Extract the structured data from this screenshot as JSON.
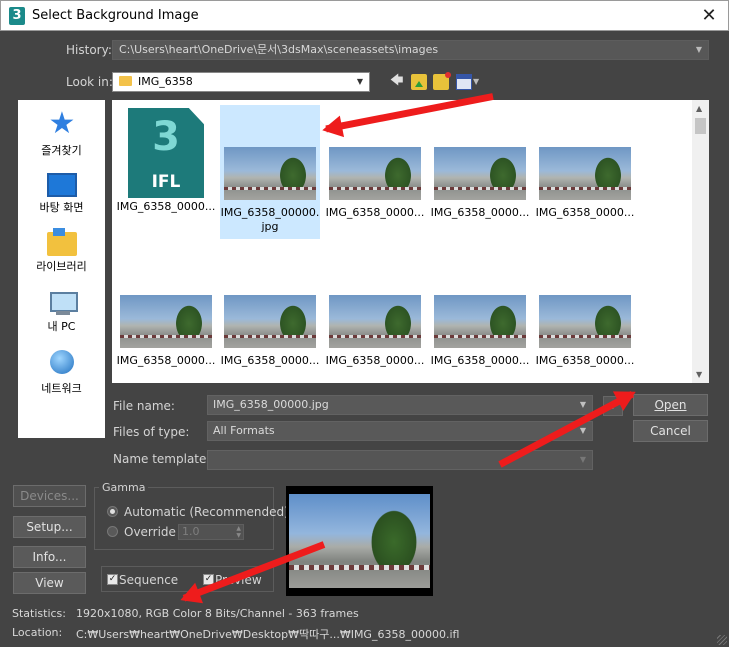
{
  "window": {
    "title": "Select Background Image",
    "close": "✕",
    "app_glyph": "3"
  },
  "history": {
    "label": "History:",
    "value": "C:\\Users\\heart\\OneDrive\\문서\\3dsMax\\sceneassets\\images"
  },
  "look_in": {
    "label": "Look in:",
    "value": "IMG_6358"
  },
  "places": [
    {
      "label": "즐겨찾기",
      "icon": "favorites-star-icon"
    },
    {
      "label": "바탕 화면",
      "icon": "desktop-icon"
    },
    {
      "label": "라이브러리",
      "icon": "library-icon"
    },
    {
      "label": "내 PC",
      "icon": "this-pc-icon"
    },
    {
      "label": "네트워크",
      "icon": "network-icon"
    }
  ],
  "files": [
    {
      "name": "IMG_6358_0000...",
      "type": "ifl",
      "icon_text": "3",
      "ext": "IFL"
    },
    {
      "name": "IMG_6358_00000.jpg",
      "type": "image",
      "selected": true
    },
    {
      "name": "IMG_6358_0000...",
      "type": "image"
    },
    {
      "name": "IMG_6358_0000...",
      "type": "image"
    },
    {
      "name": "IMG_6358_0000...",
      "type": "image"
    },
    {
      "name": "IMG_6358_0000...",
      "type": "image"
    },
    {
      "name": "IMG_6358_0000...",
      "type": "image"
    },
    {
      "name": "IMG_6358_0000...",
      "type": "image"
    },
    {
      "name": "IMG_6358_0000...",
      "type": "image"
    },
    {
      "name": "IMG_6358_0000...",
      "type": "image"
    }
  ],
  "file_name": {
    "label": "File name:",
    "value": "IMG_6358_00000.jpg"
  },
  "files_of_type": {
    "label": "Files of type:",
    "value": "All Formats"
  },
  "name_template": {
    "label": "Name template:",
    "value": ""
  },
  "buttons": {
    "open": "Open",
    "cancel": "Cancel",
    "plus": "+",
    "devices": "Devices...",
    "setup": "Setup...",
    "info": "Info...",
    "view": "View"
  },
  "gamma": {
    "title": "Gamma",
    "automatic": "Automatic (Recommended)",
    "override": "Override",
    "override_value": "1.0",
    "selected": "automatic"
  },
  "options": {
    "sequence": "Sequence",
    "sequence_checked": true,
    "preview": "Preview",
    "preview_checked": true,
    "check_glyph": "✓"
  },
  "status": {
    "statistics_label": "Statistics:",
    "statistics_value": "1920x1080, RGB Color 8 Bits/Channel - 363 frames",
    "location_label": "Location:",
    "location_value": "C:₩Users₩heart₩OneDrive₩Desktop₩딱따구...₩IMG_6358_00000.ifl"
  },
  "glyphs": {
    "dropdown": "▼",
    "back": "🡄",
    "scroll_up": "▲",
    "scroll_down": "▼",
    "spin_up": "▲",
    "spin_down": "▼"
  },
  "colors": {
    "dialog_bg": "#444444",
    "selection": "#cce8ff",
    "annotation": "#ee1c1c"
  }
}
